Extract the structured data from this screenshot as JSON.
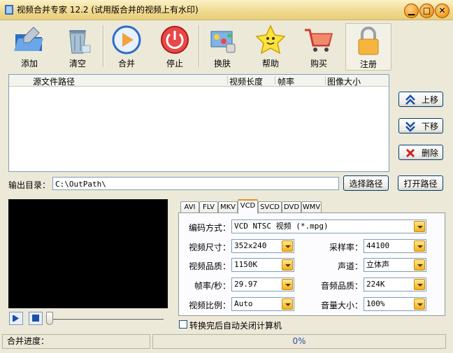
{
  "window": {
    "title": "视频合并专家 12.2 (试用版合并的视频上有水印)"
  },
  "toolbar": {
    "items": [
      {
        "label": "添加",
        "icon": "folder-icon"
      },
      {
        "label": "清空",
        "icon": "trash-icon"
      },
      {
        "label": "合并",
        "icon": "play-icon"
      },
      {
        "label": "停止",
        "icon": "power-icon"
      },
      {
        "label": "换肤",
        "icon": "skin-icon"
      },
      {
        "label": "帮助",
        "icon": "star-icon"
      },
      {
        "label": "购买",
        "icon": "cart-icon"
      },
      {
        "label": "注册",
        "icon": "lock-icon"
      }
    ]
  },
  "filelist": {
    "columns": [
      "源文件路径",
      "视频长度",
      "帧率",
      "图像大小"
    ],
    "rows": []
  },
  "side_buttons": {
    "up": "上移",
    "down": "下移",
    "delete": "删除"
  },
  "output": {
    "label": "输出目录：",
    "path": "C:\\OutPath\\",
    "choose_label": "选择路径",
    "open_label": "打开路径"
  },
  "tabs": [
    "AVI",
    "FLV",
    "MKV",
    "VCD",
    "SVCD",
    "DVD",
    "WMV"
  ],
  "active_tab": "VCD",
  "settings": {
    "codec": {
      "label": "编码方式：",
      "value": "VCD NTSC 视频 (*.mpg)"
    },
    "size": {
      "label": "视频尺寸：",
      "value": "352x240"
    },
    "quality": {
      "label": "视频品质：",
      "value": "1150K"
    },
    "fps": {
      "label": "帧率/秒：",
      "value": "29.97"
    },
    "aspect": {
      "label": "视频比例：",
      "value": "Auto"
    },
    "samplerate": {
      "label": "采样率：",
      "value": "44100"
    },
    "channels": {
      "label": "声道：",
      "value": "立体声"
    },
    "audio_quality": {
      "label": "音频品质：",
      "value": "224K"
    },
    "volume": {
      "label": "音量大小：",
      "value": "100%"
    }
  },
  "shutdown": {
    "label": "转换完后自动关闭计算机",
    "checked": false
  },
  "status": {
    "label": "合并进度：",
    "percent": "0%",
    "progress": 0
  },
  "colors": {
    "titlebar": "#efd98f",
    "accent": "#e68b2c",
    "window_bg": "#ece9d8"
  }
}
